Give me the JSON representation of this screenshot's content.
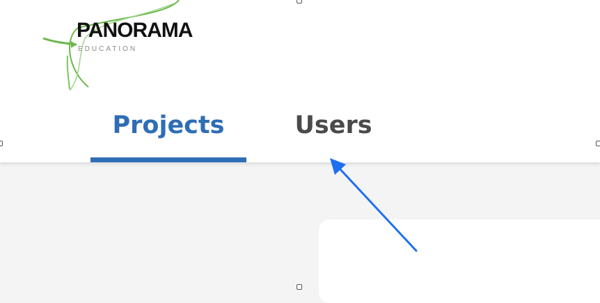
{
  "logo": {
    "name": "PANORAMA",
    "subtitle": "EDUCATION"
  },
  "tabs": [
    {
      "label": "Projects",
      "active": true
    },
    {
      "label": "Users",
      "active": false
    }
  ],
  "colors": {
    "accent": "#2f6db5",
    "inactive_tab": "#4a4a4a",
    "logo_green": "#6ab84a",
    "annotation_arrow": "#1f6ff0"
  }
}
